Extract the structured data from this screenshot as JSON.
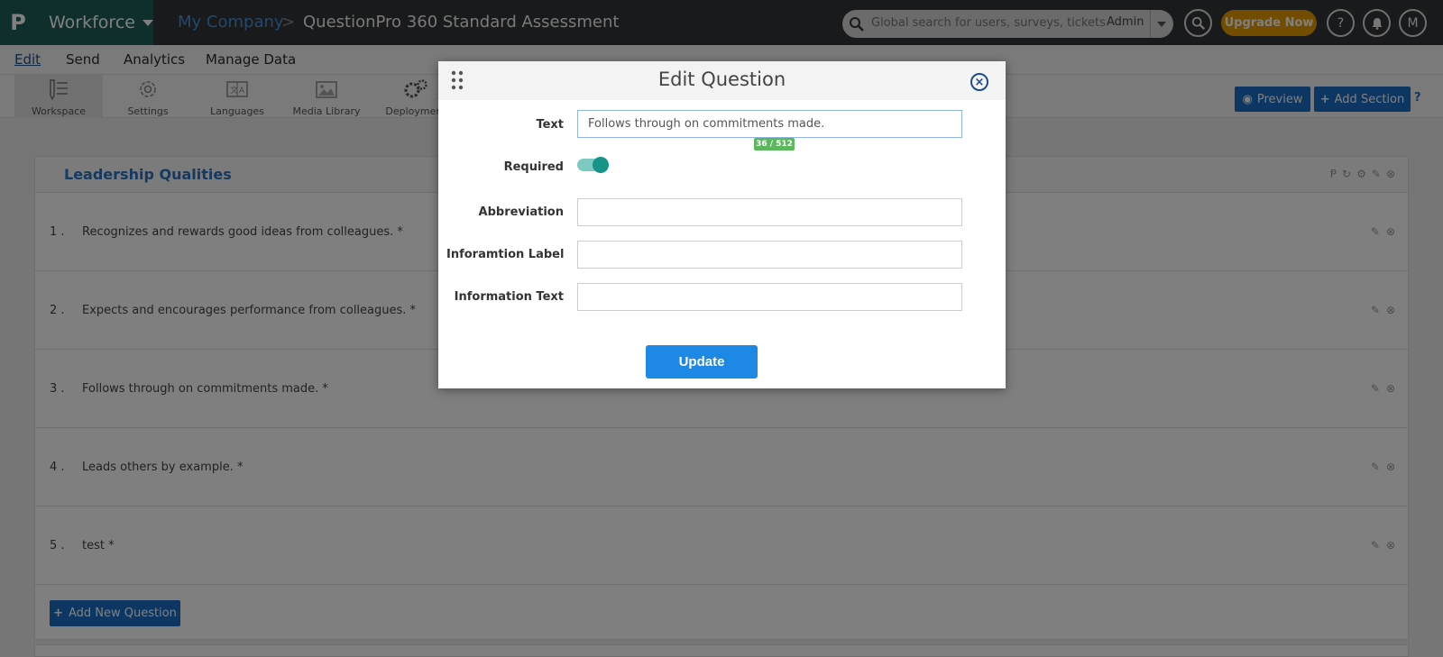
{
  "topbar": {
    "logo": "P",
    "product": "Workforce",
    "company": "My Company",
    "separator": ">",
    "title": "QuestionPro 360 Standard Assessment",
    "search_placeholder": "Global search for users, surveys, tickets",
    "search_scope": "Admin",
    "upgrade": "Upgrade Now",
    "help": "?",
    "avatar": "M"
  },
  "nav": {
    "items": [
      "Edit",
      "Send",
      "Analytics",
      "Manage Data"
    ]
  },
  "toolbar": {
    "items": [
      "Workspace",
      "Settings",
      "Languages",
      "Media Library",
      "Deployment"
    ],
    "preview": "Preview",
    "add_section": "Add Section"
  },
  "section": {
    "title": "Leadership Qualities",
    "questions": [
      {
        "num": "1 .",
        "text": "Recognizes and rewards good ideas from colleagues. *"
      },
      {
        "num": "2 .",
        "text": "Expects and encourages performance from colleagues. *"
      },
      {
        "num": "3 .",
        "text": "Follows through on commitments made. *"
      },
      {
        "num": "4 .",
        "text": "Leads others by example. *"
      },
      {
        "num": "5 .",
        "text": "test *"
      }
    ],
    "add_question": "Add New Question"
  },
  "modal": {
    "title": "Edit Question",
    "close": "×",
    "text_label": "Text",
    "text_value": "Follows through on commitments made.",
    "counter": "36 / 512",
    "required_label": "Required",
    "required_on": true,
    "abbreviation_label": "Abbreviation",
    "info_label_label": "Inforamtion Label",
    "info_text_label": "Information Text",
    "update": "Update"
  },
  "colors": {
    "brand": "#1f5f5b",
    "accent": "#1a6fc4",
    "upgrade": "#e59a00",
    "toggle": "#169488"
  }
}
